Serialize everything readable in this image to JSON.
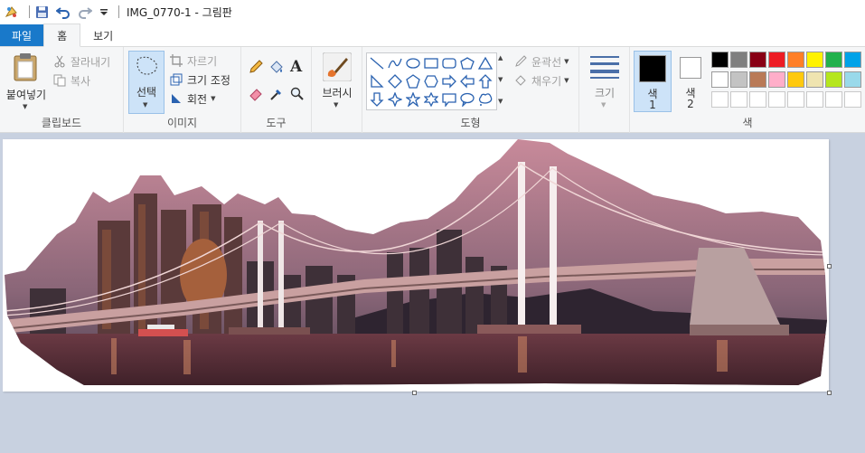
{
  "titlebar": {
    "title": "IMG_0770-1 - 그림판",
    "qa_icons": [
      "paint-app-icon",
      "save-icon",
      "undo-icon",
      "redo-icon",
      "customize-dropdown-icon"
    ]
  },
  "tabs": [
    "파일",
    "홈",
    "보기"
  ],
  "ribbon": {
    "clipboard": {
      "label": "클립보드",
      "paste": "붙여넣기",
      "cut": "잘라내기",
      "copy": "복사"
    },
    "image": {
      "label": "이미지",
      "select": "선택",
      "crop": "자르기",
      "resize": "크기 조정",
      "rotate": "회전"
    },
    "tools": {
      "label": "도구"
    },
    "brushes": {
      "label": "브러시"
    },
    "shapes": {
      "label": "도형",
      "outline": "윤곽선",
      "fill": "채우기"
    },
    "size": {
      "label": "크기"
    },
    "colors": {
      "label": "색",
      "color1": "색\n1",
      "color1_a": "색",
      "color1_b": "1",
      "color2_a": "색",
      "color2_b": "2",
      "row1": [
        "#000000",
        "#7f7f7f",
        "#880015",
        "#ed1c24",
        "#ff7f27",
        "#fff200",
        "#22b14c",
        "#00a2e8"
      ],
      "row2": [
        "#ffffff",
        "#c3c3c3",
        "#b97a57",
        "#ffaec9",
        "#ffc90e",
        "#efe4b0",
        "#b5e61d",
        "#99d9ea"
      ],
      "row3": [
        "#ffffff",
        "#ffffff",
        "#ffffff",
        "#ffffff",
        "#ffffff",
        "#ffffff",
        "#ffffff",
        "#ffffff"
      ]
    }
  }
}
